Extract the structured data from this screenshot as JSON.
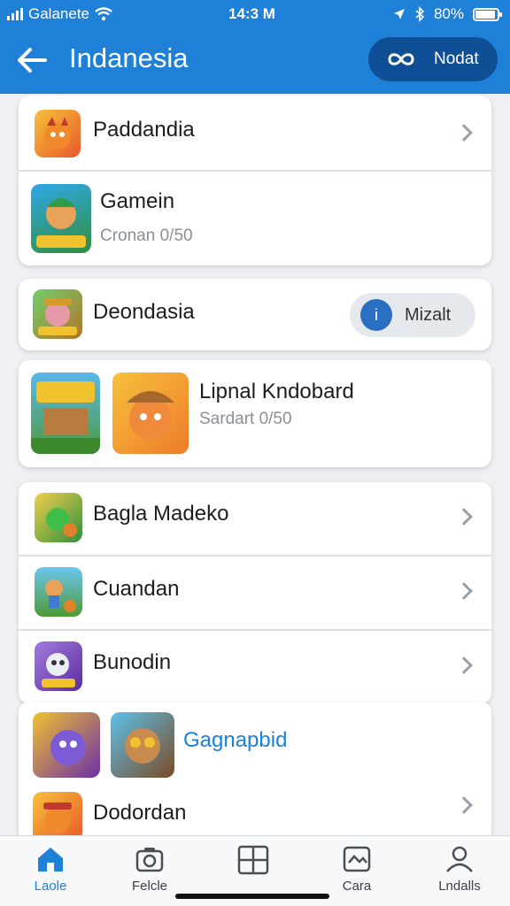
{
  "status_bar": {
    "carrier": "Galanete",
    "time": "14:3 M",
    "battery": "80%"
  },
  "header": {
    "title": "Indanesia",
    "action_label": "Nodat"
  },
  "cards": [
    {
      "rows": [
        {
          "title": "Paddandia"
        },
        {
          "title": "Gamein",
          "subtitle": "Cronan 0/50"
        }
      ]
    },
    {
      "rows": [
        {
          "title": "Deondasia",
          "button_label": "Mizalt",
          "button_icon": "i"
        }
      ]
    },
    {
      "rows": [
        {
          "title": "Lipnal Kndobard",
          "subtitle": "Sardart 0/50"
        }
      ]
    },
    {
      "rows": [
        {
          "title": "Bagla Madeko"
        },
        {
          "title": "Cuandan"
        },
        {
          "title": "Bunodin"
        }
      ]
    },
    {
      "rows": [
        {
          "title": "Gagnapbid",
          "title_color": "#1f80d8"
        },
        {
          "title": "Dodordan"
        }
      ]
    }
  ],
  "bottom_nav": [
    {
      "label": "Laole",
      "icon": "home-icon",
      "active": true
    },
    {
      "label": "Felcle",
      "icon": "camera-icon",
      "active": false
    },
    {
      "label": "",
      "icon": "grid-icon",
      "active": false
    },
    {
      "label": "Cara",
      "icon": "gallery-icon",
      "active": false
    },
    {
      "label": "Lndalls",
      "icon": "profile-icon",
      "active": false
    }
  ],
  "colors": {
    "primary": "#1f80d8",
    "header_action": "#0f4f95",
    "background": "#eef0f3"
  }
}
